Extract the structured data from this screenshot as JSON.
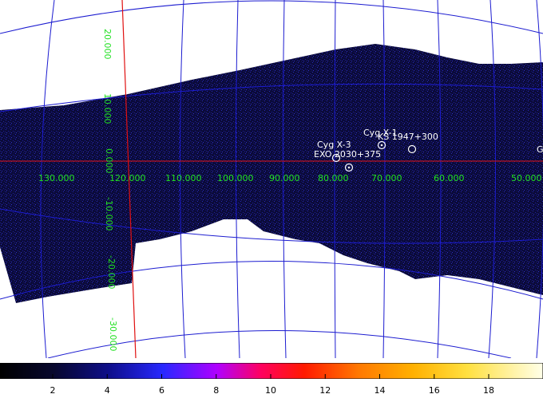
{
  "map": {
    "background_color": "#ffffff",
    "image_color": "#0b0b3a",
    "grid_color": "#1c1cd0",
    "label_color": "#22e022",
    "galactic_plane_color": "#e01010",
    "longitude_labels": [
      "130.000",
      "120.000",
      "110.000",
      "100.000",
      "90.000",
      "80.000",
      "70.000",
      "60.000",
      "50.000"
    ],
    "latitude_labels": [
      "20.000",
      "10.000",
      "0.000",
      "-10.000",
      "-20.000",
      "-30.000"
    ],
    "sources": [
      {
        "name": "Cyg X-1",
        "label": "Cyg X-1"
      },
      {
        "name": "KS 1947+300",
        "label": "KS 1947+300"
      },
      {
        "name": "Cyg X-3",
        "label": "Cyg X-3"
      },
      {
        "name": "EXO 2030+375",
        "label": "EXO 2030+375"
      },
      {
        "name": "G",
        "label": "G"
      }
    ]
  },
  "colorbar": {
    "ticks": [
      "2",
      "4",
      "6",
      "8",
      "10",
      "12",
      "14",
      "16",
      "18"
    ]
  }
}
